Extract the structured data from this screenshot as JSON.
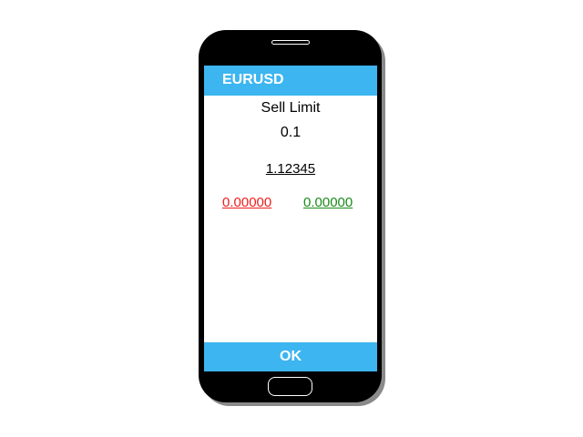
{
  "header": {
    "symbol": "EURUSD"
  },
  "order": {
    "type": "Sell Limit",
    "volume": "0.1",
    "price": "1.12345",
    "stop_loss": "0.00000",
    "take_profit": "0.00000"
  },
  "footer": {
    "ok_label": "OK"
  },
  "colors": {
    "accent": "#3db5f0",
    "stop_loss": "#ee1c1c",
    "take_profit": "#1a8a1a",
    "phone_body": "#000000"
  }
}
